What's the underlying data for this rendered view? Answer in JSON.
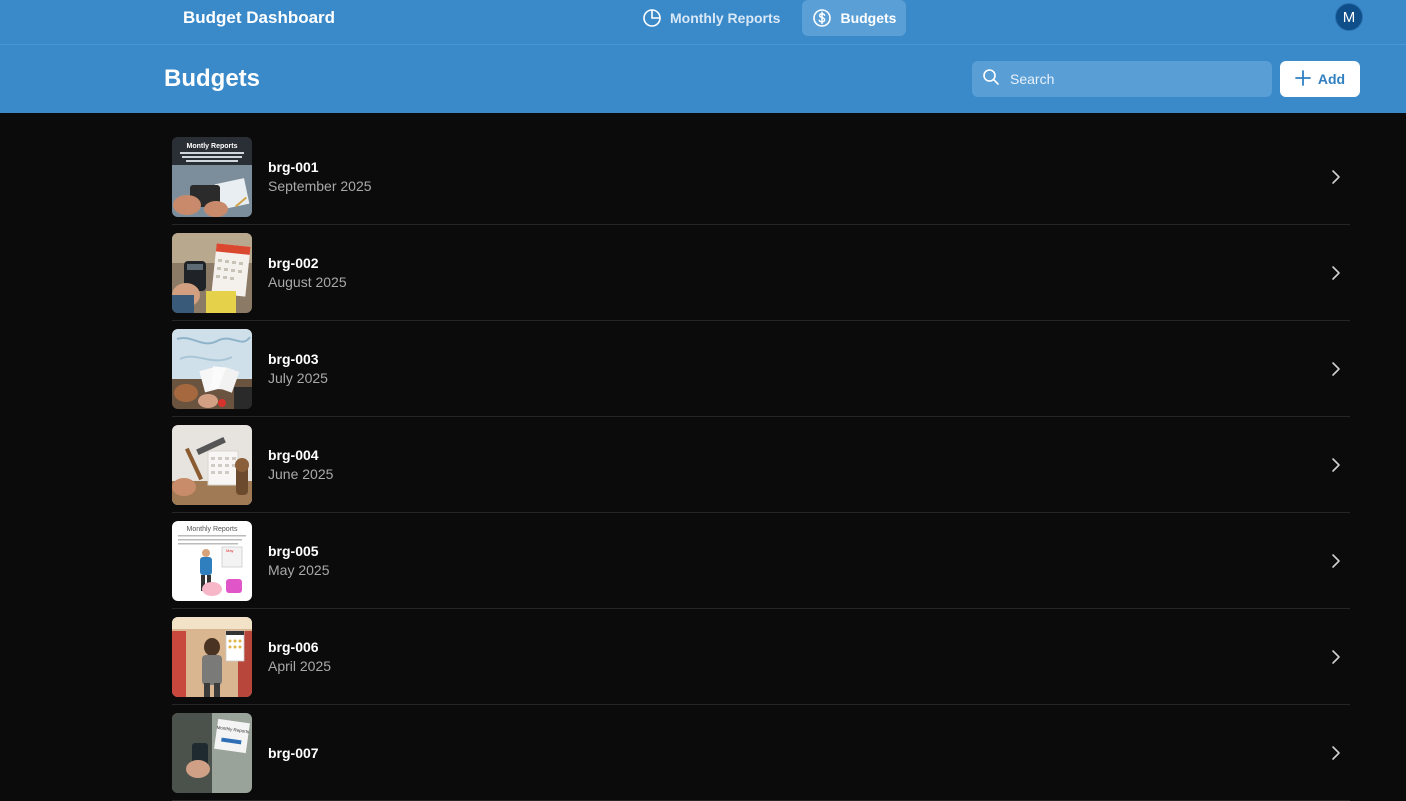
{
  "app": {
    "title": "Budget Dashboard",
    "avatar_initial": "M"
  },
  "nav": {
    "items": [
      {
        "label": "Monthly Reports",
        "icon": "pie-chart-icon",
        "active": false
      },
      {
        "label": "Budgets",
        "icon": "dollar-circle-icon",
        "active": true
      }
    ]
  },
  "header": {
    "title": "Budgets",
    "search_placeholder": "Search",
    "add_label": "Add"
  },
  "budgets": [
    {
      "id": "brg-001",
      "date": "September 2025",
      "thumb": "monthly-reports-wallet-thumbnail"
    },
    {
      "id": "brg-002",
      "date": "August 2025",
      "thumb": "calculator-calendar-thumbnail"
    },
    {
      "id": "brg-003",
      "date": "July 2025",
      "thumb": "map-receipts-thumbnail"
    },
    {
      "id": "brg-004",
      "date": "June 2025",
      "thumb": "hammer-calendar-thumbnail"
    },
    {
      "id": "brg-005",
      "date": "May 2025",
      "thumb": "monthly-reports-piggybank-thumbnail"
    },
    {
      "id": "brg-006",
      "date": "April 2025",
      "thumb": "shopper-calendar-thumbnail"
    },
    {
      "id": "brg-007",
      "date": "",
      "thumb": "monthly-reports-phone-thumbnail"
    }
  ],
  "thumb_text": {
    "brg-001": "Montly Reports",
    "brg-005": "Monthly Reports",
    "brg-007": "Monthly Reports"
  },
  "colors": {
    "header_bg": "#3a89c9",
    "active_nav_bg": "#5a9fd6",
    "page_bg": "#0b0b0b",
    "secondary_text": "#a9a9a9",
    "add_button_text": "#2f7fc1"
  }
}
